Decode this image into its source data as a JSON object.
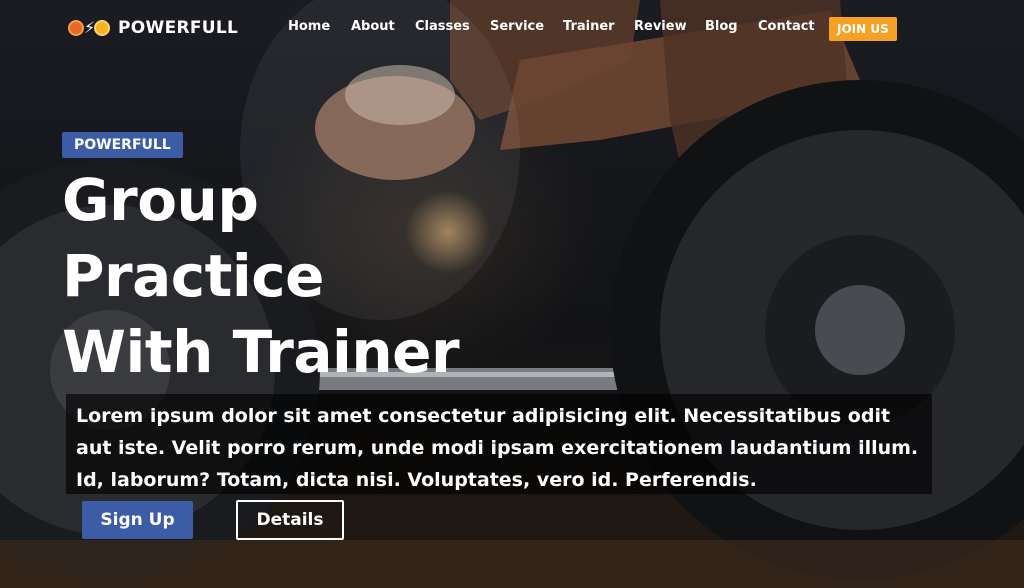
{
  "brand": {
    "name": "POWERFULL",
    "logo_icon": "dumbbell-bolt-icon"
  },
  "nav": {
    "items": [
      "Home",
      "About",
      "Classes",
      "Service",
      "Trainer",
      "Review",
      "Blog",
      "Contact"
    ],
    "cta": "JOIN US"
  },
  "hero": {
    "tag": "POWERFULL",
    "headline_lines": [
      "Group",
      "Practice",
      "With Trainer"
    ],
    "description": "Lorem ipsum dolor sit amet consectetur adipisicing elit. Necessitatibus odit aut iste. Velit porro rerum, unde modi ipsam exercitationem laudantium illum. Id, laborum? Totam, dicta nisi. Voluptates, vero id. Perferendis.",
    "primary_button": "Sign Up",
    "secondary_button": "Details"
  },
  "colors": {
    "accent_blue": "#3d5ca6",
    "accent_orange": "#f6a124"
  }
}
